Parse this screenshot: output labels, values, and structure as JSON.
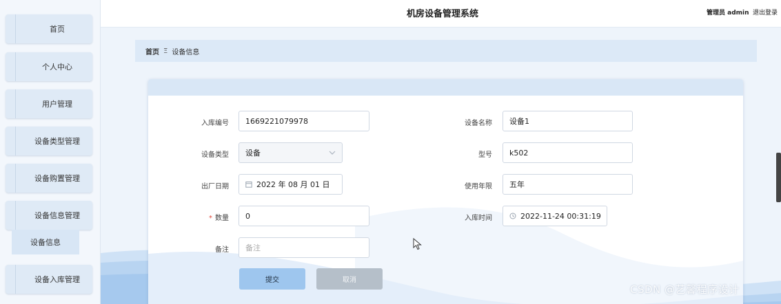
{
  "header": {
    "title": "机房设备管理系统",
    "user": "管理员 admin",
    "logout": "退出登录"
  },
  "sidebar": {
    "items": [
      {
        "label": "首页"
      },
      {
        "label": "个人中心"
      },
      {
        "label": "用户管理"
      },
      {
        "label": "设备类型管理"
      },
      {
        "label": "设备购置管理"
      },
      {
        "label": "设备信息管理"
      },
      {
        "label": "设备入库管理"
      }
    ],
    "sub_item": "设备信息"
  },
  "breadcrumb": {
    "home": "首页",
    "separator": "Ξ",
    "current": "设备信息"
  },
  "form": {
    "stock_no": {
      "label": "入库编号",
      "value": "1669221079978"
    },
    "device_name": {
      "label": "设备名称",
      "value": "设备1"
    },
    "device_type": {
      "label": "设备类型",
      "value": "设备"
    },
    "model": {
      "label": "型号",
      "value": "k502"
    },
    "mfg_date": {
      "label": "出厂日期",
      "value": "2022 年 08 月 01 日"
    },
    "service_life": {
      "label": "使用年限",
      "value": "五年"
    },
    "quantity": {
      "label": "数量",
      "required": "*",
      "value": "0"
    },
    "stock_time": {
      "label": "入库时间",
      "value": "2022-11-24 00:31:19"
    },
    "remark": {
      "label": "备注",
      "placeholder": "备注"
    }
  },
  "buttons": {
    "submit": "提交",
    "cancel": "取消"
  },
  "watermark": "CSDN @艺馨程序设计",
  "colors": {
    "accent": "#9ec6ee",
    "sidebar_bg": "#dfeaf6",
    "breadcrumb_bg": "#dce9f7",
    "required": "#e0483a"
  }
}
